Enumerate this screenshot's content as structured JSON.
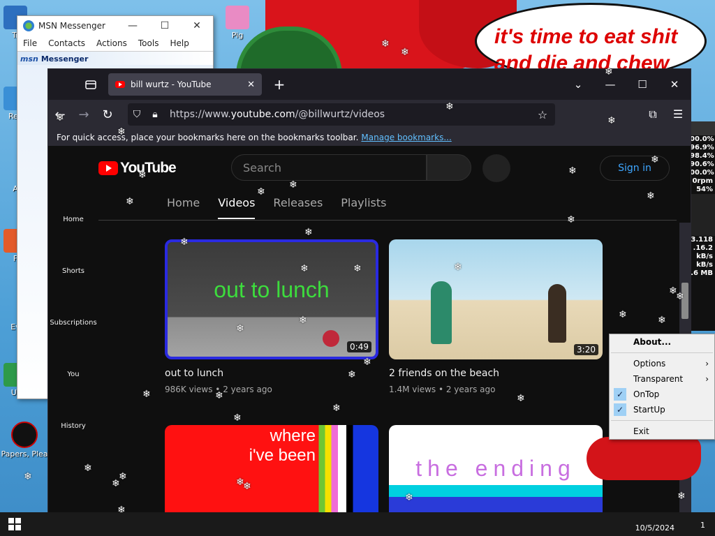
{
  "desktop": {
    "speech_bubble": "it's time to eat shit and die and chew",
    "icons": [
      {
        "label": "Tr"
      },
      {
        "label": "Rec"
      },
      {
        "label": "A"
      },
      {
        "label": "F"
      },
      {
        "label": "Ev"
      },
      {
        "label": "Ur"
      },
      {
        "label": "Papers, Plea"
      },
      {
        "label": "Pig"
      }
    ]
  },
  "msn": {
    "title": "MSN Messenger",
    "menu": [
      "File",
      "Contacts",
      "Actions",
      "Tools",
      "Help"
    ],
    "brand_logo": "msn",
    "brand_text": "Messenger"
  },
  "browser": {
    "tab_title": "bill wurtz - YouTube",
    "url_prefix": "https://www.",
    "url_domain": "youtube.com",
    "url_path": "/@billwurtz/videos",
    "bookmarks_text": "For quick access, place your bookmarks here on the bookmarks toolbar.",
    "bookmarks_link": "Manage bookmarks..."
  },
  "youtube": {
    "logo_text": "YouTube",
    "search_placeholder": "Search",
    "sign_in": "Sign in",
    "sidebar": [
      "Home",
      "Shorts",
      "Subscriptions",
      "You",
      "History"
    ],
    "channel_tabs": [
      "Home",
      "Videos",
      "Releases",
      "Playlists"
    ],
    "active_tab": "Videos",
    "videos": [
      {
        "title": "out to lunch",
        "duration": "0:49",
        "views": "986K views",
        "age": "2 years ago",
        "thumb_text": "out to lunch"
      },
      {
        "title": "2 friends on the beach",
        "duration": "3:20",
        "views": "1.4M views",
        "age": "2 years ago",
        "thumb_text": ""
      },
      {
        "title": "",
        "duration": "",
        "views": "",
        "age": "",
        "thumb_text": "where i've been"
      },
      {
        "title": "",
        "duration": "",
        "views": "",
        "age": "",
        "thumb_text": "the ending"
      }
    ]
  },
  "gauge": {
    "lines": [
      "00.0%",
      "96.9%",
      "98.4%",
      "90.6%",
      "00.0%",
      "0rpm",
      "54%",
      "",
      "3.118",
      ".16.2",
      "kB/s",
      "kB/s",
      ".6 MB"
    ]
  },
  "context_menu": {
    "items": [
      {
        "label": "About...",
        "checked": false,
        "submenu": false,
        "bold": true
      },
      {
        "label": "Options",
        "checked": false,
        "submenu": true,
        "bold": false
      },
      {
        "label": "Transparent",
        "checked": false,
        "submenu": true,
        "bold": false
      },
      {
        "label": "OnTop",
        "checked": true,
        "submenu": false,
        "bold": false
      },
      {
        "label": "StartUp",
        "checked": true,
        "submenu": false,
        "bold": false
      },
      {
        "label": "Exit",
        "checked": false,
        "submenu": false,
        "bold": false
      }
    ]
  },
  "taskbar": {
    "date": "10/5/2024",
    "notification_count": "1"
  }
}
